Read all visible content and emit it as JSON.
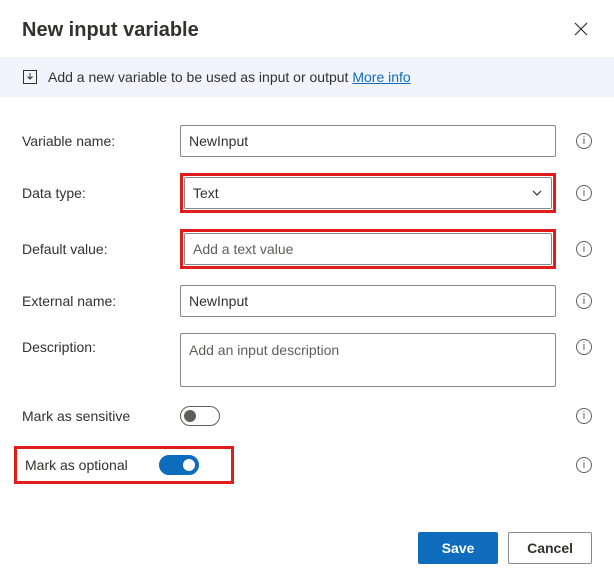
{
  "header": {
    "title": "New input variable"
  },
  "banner": {
    "text": "Add a new variable to be used as input or output",
    "link": "More info"
  },
  "fields": {
    "variable_name": {
      "label": "Variable name:",
      "value": "NewInput"
    },
    "data_type": {
      "label": "Data type:",
      "value": "Text"
    },
    "default_value": {
      "label": "Default value:",
      "placeholder": "Add a text value",
      "value": ""
    },
    "external_name": {
      "label": "External name:",
      "value": "NewInput"
    },
    "description": {
      "label": "Description:",
      "placeholder": "Add an input description",
      "value": ""
    },
    "mark_sensitive": {
      "label": "Mark as sensitive",
      "value": false
    },
    "mark_optional": {
      "label": "Mark as optional",
      "value": true
    }
  },
  "footer": {
    "save": "Save",
    "cancel": "Cancel"
  }
}
